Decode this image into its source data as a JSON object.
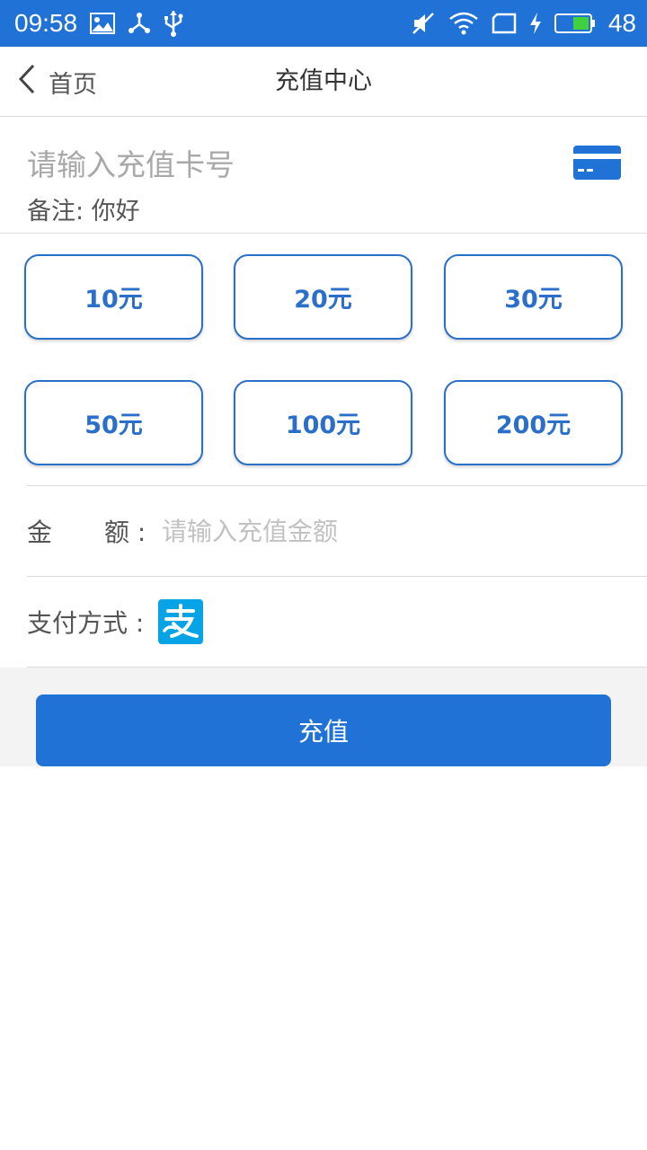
{
  "status_bar": {
    "time": "09:58",
    "battery_percent": "48",
    "color": "#2172d6"
  },
  "nav": {
    "back_label": "首页",
    "title": "充值中心"
  },
  "card": {
    "placeholder": "请输入充值卡号",
    "remark": "备注: 你好"
  },
  "amounts": [
    "10元",
    "20元",
    "30元",
    "50元",
    "100元",
    "200元"
  ],
  "amount_field": {
    "label_first": "金",
    "label_second": "额 :",
    "placeholder": "请输入充值金额"
  },
  "payment": {
    "label": "支付方式 :",
    "method_icon": "alipay-icon"
  },
  "submit_label": "充值",
  "colors": {
    "accent": "#2172d6",
    "amount_border": "#2a6fc9",
    "alipay": "#06a4e7"
  }
}
